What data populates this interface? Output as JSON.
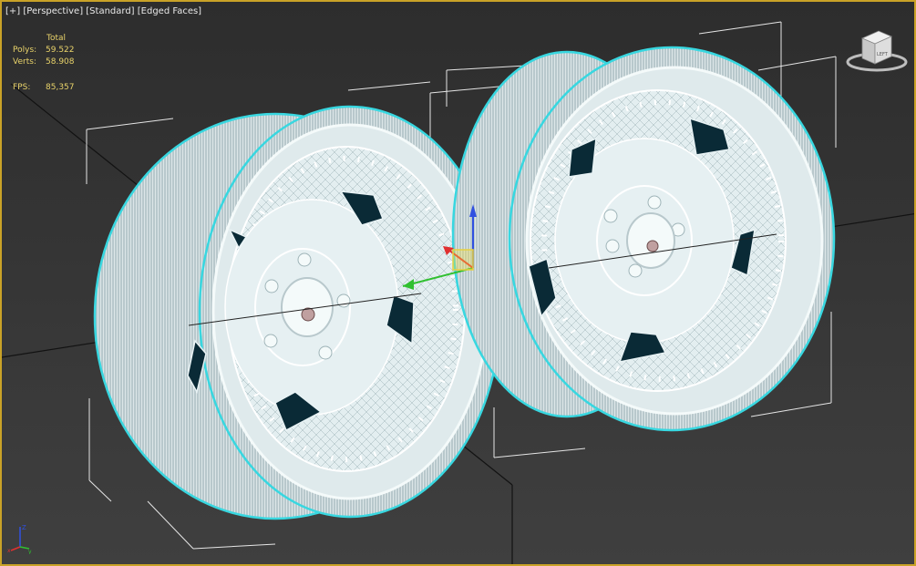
{
  "viewport": {
    "menu_plus": "[+]",
    "view_mode": "[Perspective]",
    "shading_mode": "[Standard]",
    "face_mode": "[Edged Faces]"
  },
  "stats": {
    "total_header": "Total",
    "polys_label": "Polys:",
    "polys_value": "59.522",
    "verts_label": "Verts:",
    "verts_value": "58.908",
    "fps_label": "FPS:",
    "fps_value": "85,357"
  },
  "viewcube": {
    "face_label": "LEFT"
  },
  "tripod": {
    "z_label": "Z",
    "x_label": "x",
    "y_label": "y"
  },
  "colors": {
    "frame": "#c9a227",
    "wire": "#eef6f6",
    "selection_outline": "#38d7e0",
    "hole_fill": "#0a2a36",
    "stats_text": "#e9d36a"
  },
  "icons": [
    "viewcube-icon",
    "gizmo-icon",
    "axis-tripod-icon"
  ]
}
